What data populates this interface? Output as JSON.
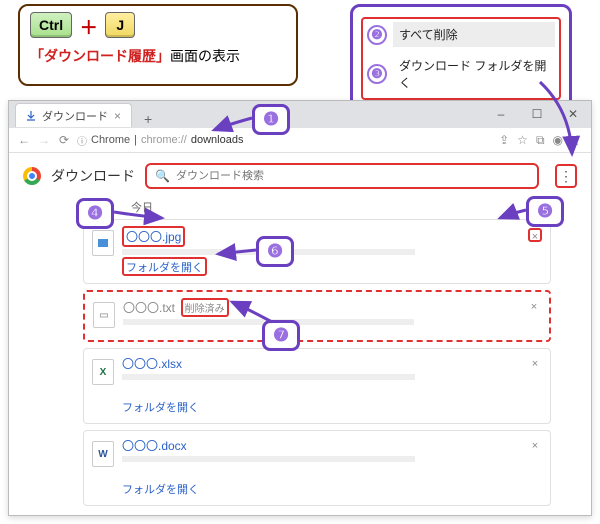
{
  "shortcut": {
    "ctrl": "Ctrl",
    "key_j": "J",
    "caption_red": "「ダウンロード履歴」",
    "caption_rest": "画面の表示"
  },
  "menu": {
    "delete_all": "すべて削除",
    "open_folder": "ダウンロード フォルダを開く"
  },
  "tab": {
    "title": "ダウンロード"
  },
  "win": {
    "min": "–",
    "max": "☐",
    "close": "✕"
  },
  "address": {
    "secure": "Chrome",
    "url_prefix": "chrome://",
    "url_path": "downloads"
  },
  "page": {
    "title": "ダウンロード",
    "search_placeholder": "ダウンロード検索"
  },
  "section": {
    "date": "今日"
  },
  "items": [
    {
      "name": "〇〇〇.jpg",
      "open": "フォルダを開く",
      "type": "img"
    },
    {
      "name": "〇〇〇.txt",
      "deleted_label": "削除済み",
      "type": "txt"
    },
    {
      "name": "〇〇〇.xlsx",
      "open": "フォルダを開く",
      "type": "xls"
    },
    {
      "name": "〇〇〇.docx",
      "open": "フォルダを開く",
      "type": "doc"
    }
  ],
  "badges": {
    "n1": "❶",
    "n2": "❷",
    "n3": "❸",
    "n4": "❹",
    "n5": "❺",
    "n6": "❻",
    "n7": "❼"
  },
  "colors": {
    "accent": "#6a3fc0",
    "highlight": "#e03030"
  }
}
